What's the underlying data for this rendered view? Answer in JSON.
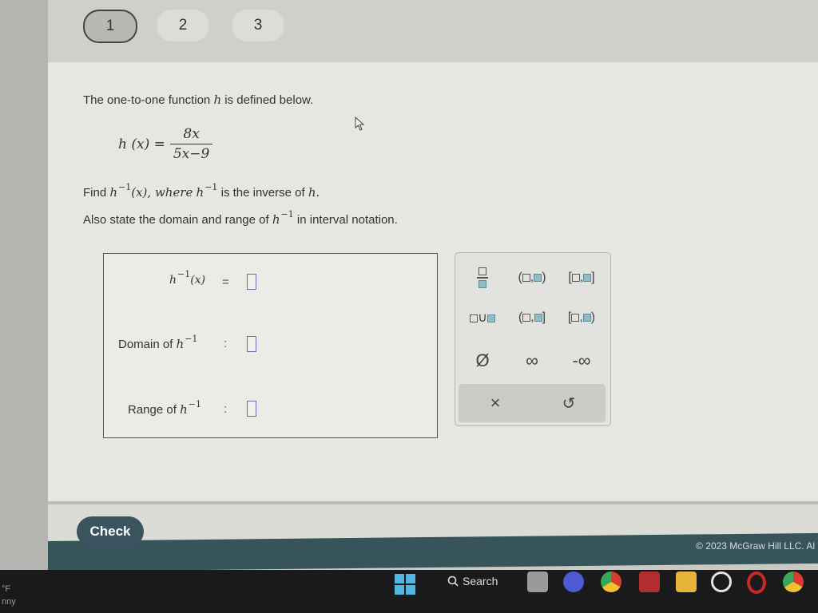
{
  "nav": {
    "questions": [
      {
        "label": "1",
        "active": true
      },
      {
        "label": "2",
        "active": false
      },
      {
        "label": "3",
        "active": false
      }
    ]
  },
  "problem": {
    "intro": "The one-to-one function",
    "fn_name": "h",
    "intro_end": "is defined below.",
    "formula_lhs": "h (x) =",
    "numerator": "8x",
    "denominator": "5x−9",
    "find_prefix": "Find",
    "find_fn": "h",
    "sup": "−1",
    "find_arg": "(x), where",
    "find_mid_fn": "h",
    "find_end": "is the inverse of",
    "find_end_fn": "h.",
    "also_prefix": "Also state the domain and range of",
    "also_fn": "h",
    "also_end": "in interval notation."
  },
  "answer": {
    "inverse_label_fn": "h",
    "inverse_label_arg": "(x)",
    "equals": "=",
    "domain_label": "Domain of",
    "range_label": "Range of",
    "label_fn": "h",
    "colon": ":",
    "sup": "−1",
    "inverse_value": "",
    "domain_value": "",
    "range_value": ""
  },
  "keypad": {
    "keys": [
      "fraction",
      "open-open-interval",
      "closed-closed-interval",
      "union",
      "open-closed-interval",
      "closed-open-interval",
      "empty-set",
      "infinity",
      "negative-infinity"
    ],
    "empty_set": "Ø",
    "infinity": "∞",
    "neg_infinity": "-∞",
    "clear": "×",
    "undo": "↺"
  },
  "footer": {
    "check_label": "Check",
    "copyright": "© 2023 McGraw Hill LLC. Al"
  },
  "taskbar": {
    "left_line1": "°F",
    "left_line2": "nny",
    "search_label": "Search"
  }
}
